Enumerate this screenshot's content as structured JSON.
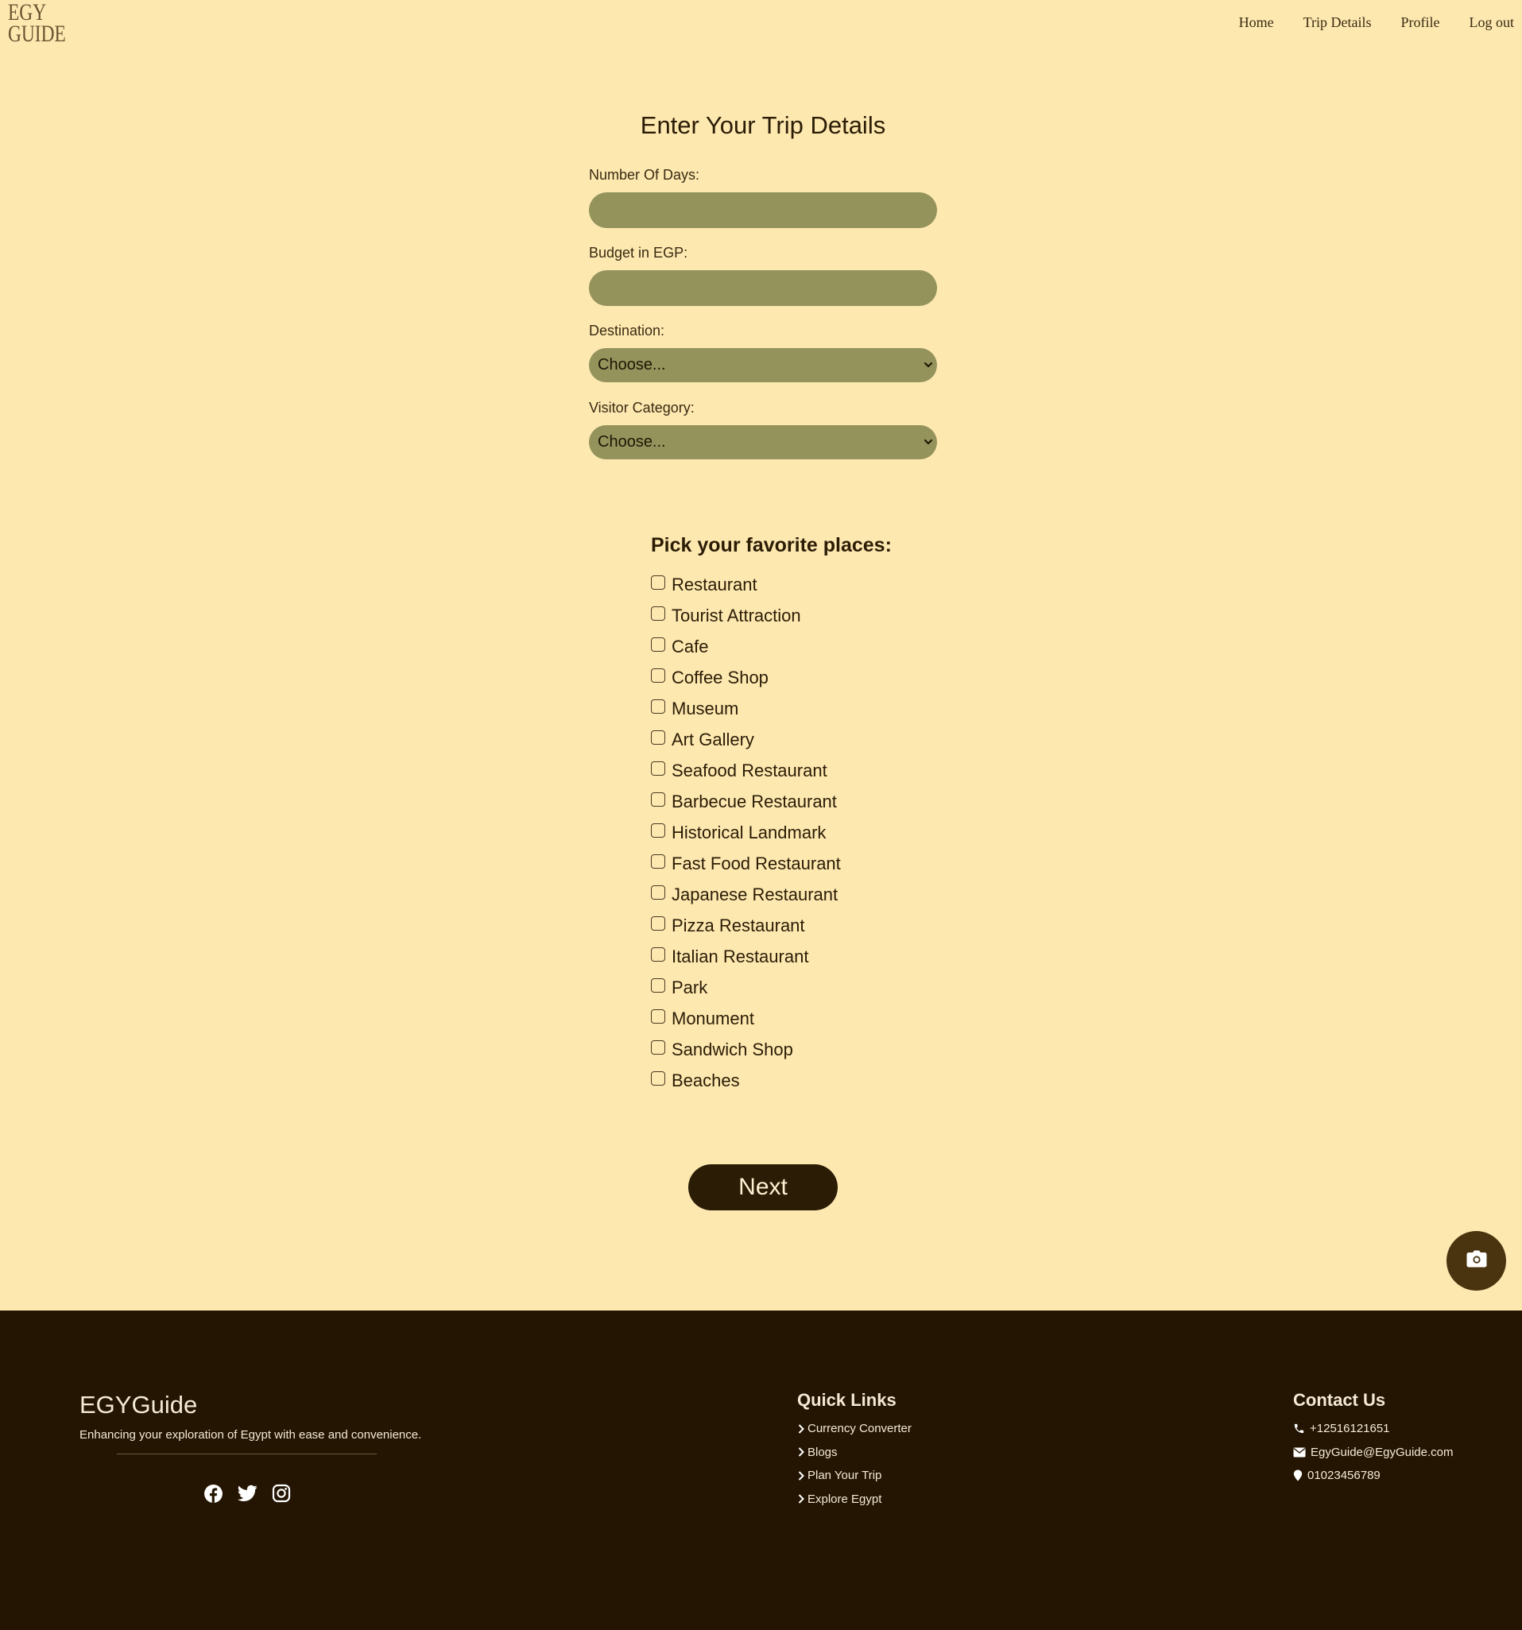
{
  "header": {
    "logo_line1": "EGY",
    "logo_line2": "GUIDE",
    "nav": {
      "home": "Home",
      "trip_details": "Trip Details",
      "profile": "Profile",
      "logout": "Log out"
    }
  },
  "form": {
    "title": "Enter Your Trip Details",
    "days_label": "Number Of Days:",
    "days_value": "",
    "budget_label": "Budget in EGP:",
    "budget_value": "",
    "destination_label": "Destination:",
    "destination_selected": "Choose...",
    "visitor_label": "Visitor Category:",
    "visitor_selected": "Choose..."
  },
  "places": {
    "title": "Pick your favorite places:",
    "items": [
      "Restaurant",
      "Tourist Attraction",
      "Cafe",
      "Coffee Shop",
      "Museum",
      "Art Gallery",
      "Seafood Restaurant",
      "Barbecue Restaurant",
      "Historical Landmark",
      "Fast Food Restaurant",
      "Japanese Restaurant",
      "Pizza Restaurant",
      "Italian Restaurant",
      "Park",
      "Monument",
      "Sandwich Shop",
      "Beaches"
    ]
  },
  "actions": {
    "next_label": "Next"
  },
  "footer": {
    "brand": "EGYGuide",
    "tagline": "Enhancing your exploration of Egypt with ease and convenience.",
    "quick_links_title": "Quick Links",
    "quick_links": [
      "Currency Converter",
      "Blogs",
      "Plan Your Trip",
      "Explore Egypt"
    ],
    "contact_title": "Contact Us",
    "phone": "+12516121651",
    "email": "EgyGuide@EgyGuide.com",
    "location": "01023456789"
  },
  "icons": {
    "social": [
      "facebook-icon",
      "twitter-icon",
      "instagram-icon"
    ],
    "fab": "camera-icon"
  },
  "colors": {
    "page_bg": "#fde8b0",
    "field_bg": "#94935c",
    "primary_dark": "#2b1c06",
    "footer_bg": "#241502",
    "fab_bg": "#4a3410"
  }
}
